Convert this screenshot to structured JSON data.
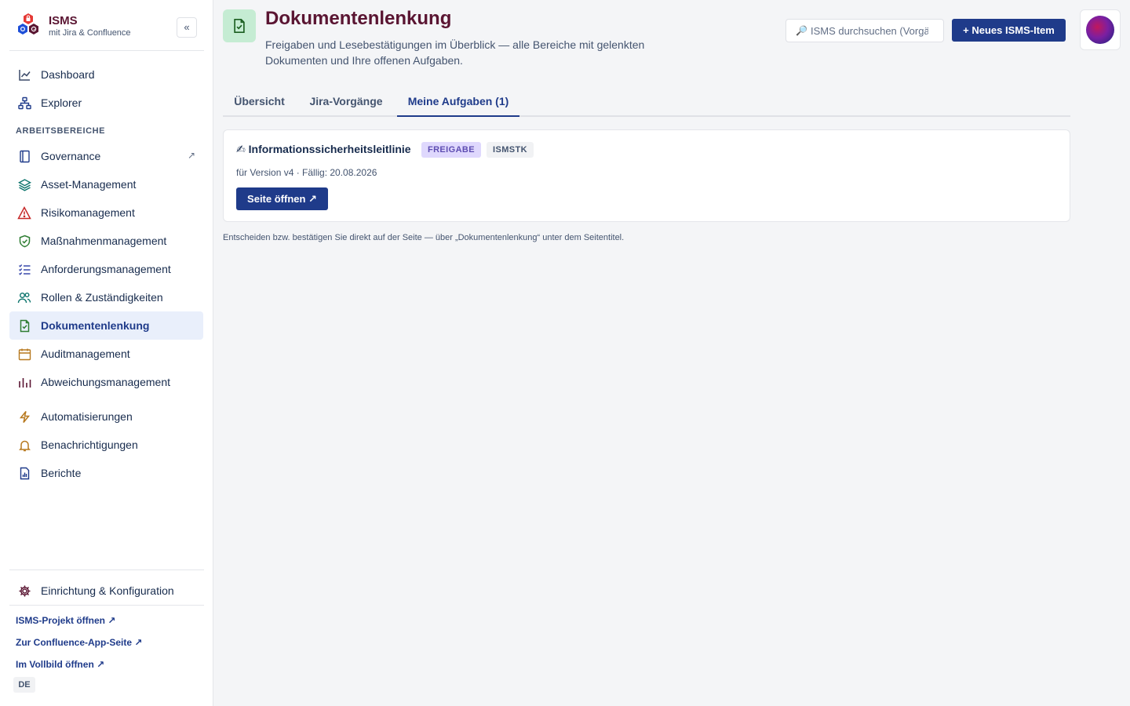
{
  "brand": {
    "title": "ISMS",
    "subtitle": "mit Jira & Confluence",
    "collapse_label": "«"
  },
  "sidebar": {
    "top_items": [
      {
        "label": "Dashboard",
        "icon": "chart-line-icon"
      },
      {
        "label": "Explorer",
        "icon": "hierarchy-icon"
      }
    ],
    "section_label": "ARBEITSBEREICHE",
    "work_items": [
      {
        "label": "Governance",
        "icon": "book-icon",
        "external": "↗"
      },
      {
        "label": "Asset-Management",
        "icon": "layers-icon"
      },
      {
        "label": "Risikomanagement",
        "icon": "warning-icon"
      },
      {
        "label": "Maßnahmenmanagement",
        "icon": "shield-check-icon"
      },
      {
        "label": "Anforderungsmanagement",
        "icon": "checklist-icon"
      },
      {
        "label": "Rollen & Zuständigkeiten",
        "icon": "people-icon"
      },
      {
        "label": "Dokumentenlenkung",
        "icon": "document-check-icon",
        "active": true
      },
      {
        "label": "Auditmanagement",
        "icon": "calendar-icon"
      },
      {
        "label": "Abweichungsmanagement",
        "icon": "bar-chart-icon"
      }
    ],
    "tool_items": [
      {
        "label": "Automatisierungen",
        "icon": "lightning-icon"
      },
      {
        "label": "Benachrichtigungen",
        "icon": "bell-icon"
      },
      {
        "label": "Berichte",
        "icon": "report-icon"
      }
    ],
    "settings_item": {
      "label": "Einrichtung & Konfiguration",
      "icon": "gear-icon"
    },
    "external_links": [
      "ISMS-Projekt öffnen ↗",
      "Zur Confluence-App-Seite ↗",
      "Im Vollbild öffnen ↗"
    ],
    "language": "DE"
  },
  "header": {
    "title": "Dokumentenlenkung",
    "description": "Freigaben und Lesebestätigungen im Überblick — alle Bereiche mit gelenkten Dokumenten und Ihre offenen Aufgaben.",
    "search_placeholder": "ISMS durchsuchen (Vorgänge, Seiten …)",
    "new_button_label": "+ Neues ISMS-Item"
  },
  "tabs": [
    {
      "label": "Übersicht"
    },
    {
      "label": "Jira-Vorgänge"
    },
    {
      "label": "Meine Aufgaben (1)",
      "active": true
    }
  ],
  "task": {
    "emoji": "✍",
    "title": "Informationssicherheitsleitlinie",
    "status": "FREIGABE",
    "project_key": "ISMSTK",
    "meta": "für Version v4 · Fällig: 20.08.2026",
    "open_label": "Seite öffnen ↗"
  },
  "hint": "Entscheiden bzw. bestätigen Sie direkt auf der Seite — über „Dokumentenlenkung“ unter dem Seitentitel.",
  "colors": {
    "accent": "#1f3b8a",
    "title": "#5a1532",
    "freigabe_bg": "#dfd8fd",
    "freigabe_text": "#5e4db2",
    "page_icon_bg": "#c5ecd3"
  }
}
